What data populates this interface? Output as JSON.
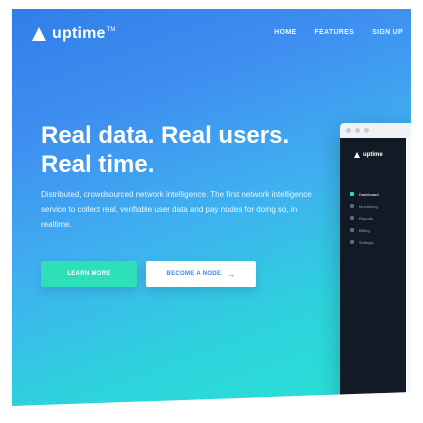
{
  "brand": {
    "name": "uptime",
    "tm": "TM"
  },
  "nav": {
    "items": [
      "HOME",
      "FEATURES",
      "SIGN UP"
    ]
  },
  "hero": {
    "headline_line1": "Real data. Real users.",
    "headline_line2": "Real time.",
    "description": "Distributed, crowdsourced network intelligence. The first network intelligence service to collect real, verifiable user data and pay nodes for doing so, in realtime.",
    "primary_button": "LEARN MORE",
    "secondary_button": "BECOME A NODE",
    "arrow": "→"
  },
  "mockup": {
    "brand": "uptime",
    "menu": [
      "Dashboard",
      "Monitoring",
      "Reports",
      "Billing",
      "Settings"
    ],
    "active_index": 0
  },
  "colors": {
    "gradient_top": "#2f7fe9",
    "gradient_bottom": "#29e3d4",
    "accent": "#2ee0b8"
  }
}
